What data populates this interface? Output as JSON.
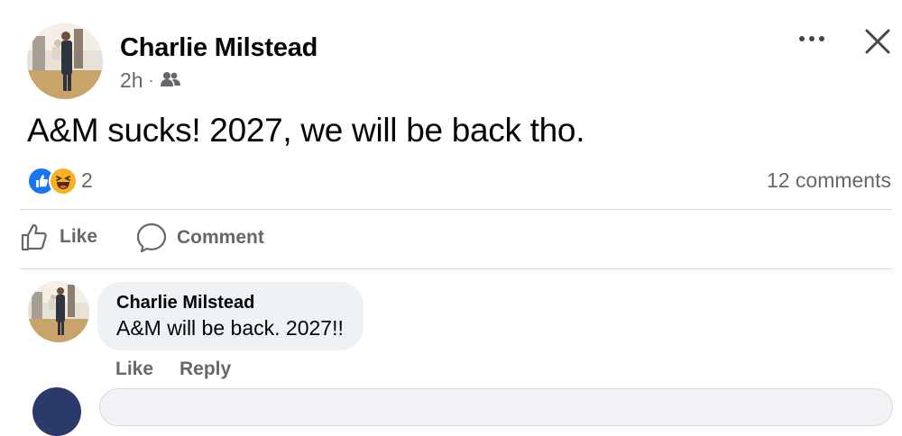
{
  "post": {
    "author": "Charlie Milstead",
    "time": "2h",
    "separator": "·",
    "audience_icon": "friends-icon",
    "text": "A&M sucks! 2027, we will be back tho.",
    "reaction_count": "2",
    "comments_count": "12 comments"
  },
  "actions": {
    "like": "Like",
    "comment": "Comment"
  },
  "comment": {
    "author": "Charlie Milstead",
    "text": "A&M will be back. 2027!!",
    "like": "Like",
    "reply": "Reply"
  },
  "colors": {
    "like_blue": "#1877f2",
    "haha_yellow": "#f7b125",
    "secondary_text": "#65676b",
    "bubble_bg": "#eff2f5"
  }
}
